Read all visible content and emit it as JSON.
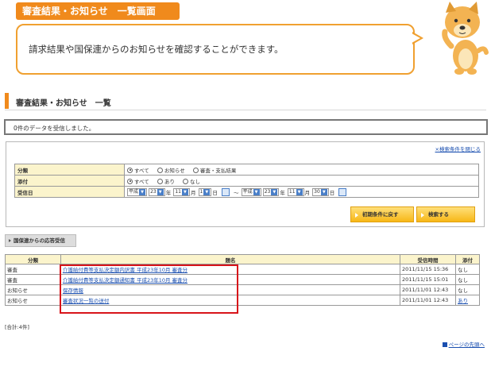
{
  "header": {
    "tab_title": "審査結果・お知らせ　一覧画面",
    "bubble_text": "請求結果や国保連からのお知らせを確認することができます。"
  },
  "page": {
    "title": "審査結果・お知らせ　一覧",
    "message": "0件のデータを受信しました。"
  },
  "search": {
    "close_label": "×検索条件を閉じる",
    "rows": {
      "category": {
        "label": "分類",
        "options": [
          "すべて",
          "お知らせ",
          "審査・支払結果"
        ],
        "selected": 0
      },
      "attachment": {
        "label": "添付",
        "options": [
          "すべて",
          "あり",
          "なし"
        ],
        "selected": 0
      },
      "received": {
        "label": "受信日",
        "from": {
          "era": "平成",
          "year": "23",
          "month": "11",
          "day": "1"
        },
        "to": {
          "era": "平成",
          "year": "23",
          "month": "11",
          "day": "30"
        },
        "year_unit": "年",
        "month_unit": "月",
        "day_unit": "日",
        "range_sep": "〜"
      }
    },
    "reset_label": "初期条件に戻す",
    "search_label": "検索する"
  },
  "section_tab": "国保連からの応答受信",
  "results": {
    "headers": [
      "分類",
      "題名",
      "受信時間",
      "添付"
    ],
    "rows": [
      {
        "category": "審査",
        "title": "介護給付費等支払決定額内訳書 平成23年10月 審査分",
        "time": "2011/11/15 15:36",
        "attach": "なし",
        "attach_link": false
      },
      {
        "category": "審査",
        "title": "介護給付費等支払決定額通知書 平成23年10月 審査分",
        "time": "2011/11/15 15:01",
        "attach": "なし",
        "attach_link": false
      },
      {
        "category": "お知らせ",
        "title": "保存情報",
        "time": "2011/11/01 12:43",
        "attach": "なし",
        "attach_link": false
      },
      {
        "category": "お知らせ",
        "title": "審査状況一覧の送付",
        "time": "2011/11/01 12:43",
        "attach": "あり",
        "attach_link": true
      }
    ]
  },
  "total": "[合計:4件]",
  "page_top": "ページの先頭へ",
  "colors": {
    "accent": "#f08a1c",
    "label_bg": "#fbf4cc",
    "link": "#1a4fb0",
    "highlight": "#d8141a"
  }
}
